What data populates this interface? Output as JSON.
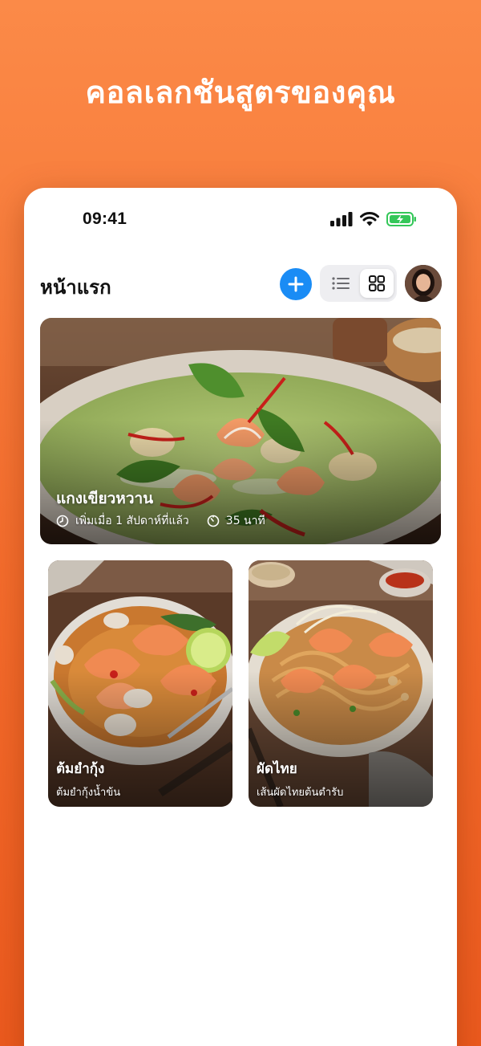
{
  "headline": "คอลเลกชันสูตรของคุณ",
  "status_bar": {
    "time": "09:41"
  },
  "nav": {
    "title": "หน้าแรก"
  },
  "icons": {
    "add": "plus-icon",
    "list_view": "list-icon",
    "grid_view": "grid-icon",
    "clock": "clock-icon",
    "timer": "timer-icon"
  },
  "colors": {
    "accent": "#1a8cf5",
    "background": "#f46c2c",
    "battery": "#34c759"
  },
  "recipes": [
    {
      "title": "แกงเขียวหวาน",
      "added": "เพิ่มเมื่อ 1 สัปดาห์ที่แล้ว",
      "duration": "35 นาที"
    },
    {
      "title": "ต้มยำกุ้ง",
      "subtitle": "ต้มยำกุ้งน้ำข้น"
    },
    {
      "title": "ผัดไทย",
      "subtitle": "เส้นผัดไทยต้นตำรับ"
    }
  ]
}
